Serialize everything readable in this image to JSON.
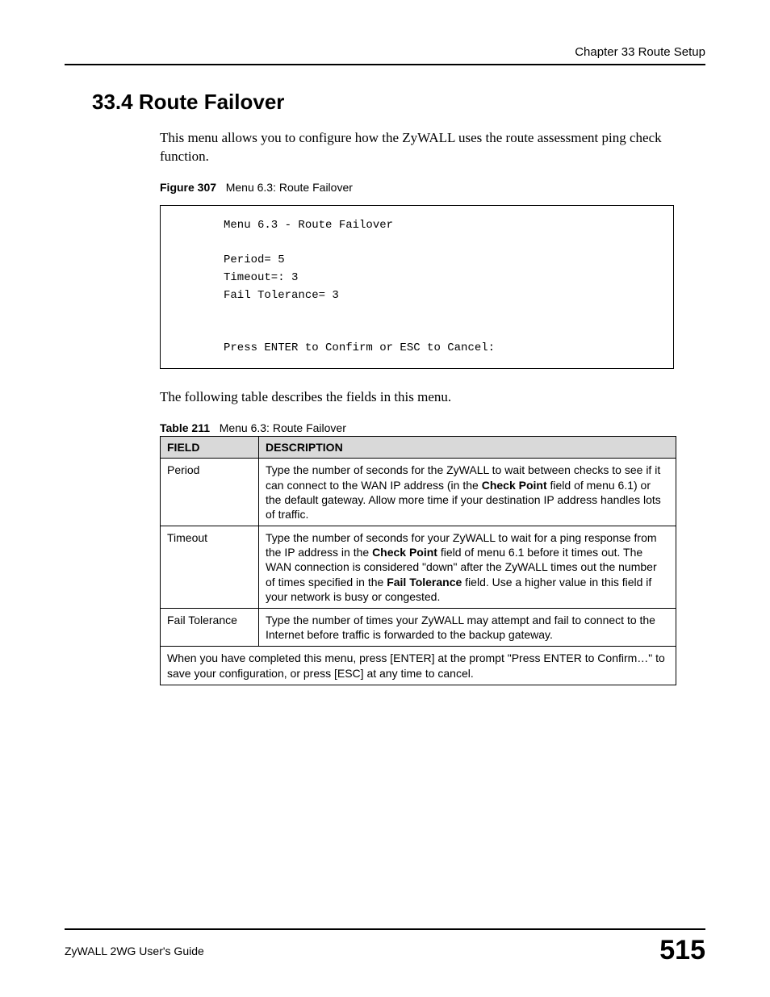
{
  "header": {
    "chapter": "Chapter 33 Route Setup"
  },
  "section": {
    "number_title": "33.4  Route Failover",
    "intro": "This menu allows you to configure how the ZyWALL uses the route assessment ping check function."
  },
  "figure": {
    "label": "Figure 307",
    "caption": "Menu 6.3: Route Failover",
    "terminal": "Menu 6.3 - Route Failover\n\nPeriod= 5\nTimeout=: 3\nFail Tolerance= 3\n\n\nPress ENTER to Confirm or ESC to Cancel:"
  },
  "table_intro": "The following table describes the fields in this menu.",
  "table": {
    "label": "Table 211",
    "caption": "Menu 6.3: Route Failover",
    "headers": {
      "field": "FIELD",
      "description": "DESCRIPTION"
    },
    "rows": [
      {
        "field": "Period",
        "desc_pre": "Type the number of seconds for the ZyWALL to wait between checks to see if it can connect to the WAN IP address (in the ",
        "desc_bold1": "Check Point",
        "desc_post": " field of menu 6.1) or the default gateway. Allow more time if your destination IP address handles lots of traffic."
      },
      {
        "field": "Timeout",
        "desc_pre": "Type the number of seconds for your ZyWALL to wait for a ping response from the IP address in the ",
        "desc_bold1": "Check Point",
        "desc_mid": " field of menu 6.1 before it times out. The WAN connection is considered \"down\" after the ZyWALL times out the number of times specified in the ",
        "desc_bold2": "Fail Tolerance",
        "desc_post": " field. Use a higher value in this field if your network is busy or congested."
      },
      {
        "field": "Fail Tolerance",
        "desc_pre": "Type the number of times your ZyWALL may attempt and fail to connect to the Internet before traffic is forwarded to the backup gateway."
      }
    ],
    "footer_row": "When you have completed this menu, press [ENTER] at the prompt \"Press ENTER to Confirm…\" to save your configuration, or press [ESC] at any time to cancel."
  },
  "footer": {
    "guide": "ZyWALL 2WG User's Guide",
    "page": "515"
  }
}
